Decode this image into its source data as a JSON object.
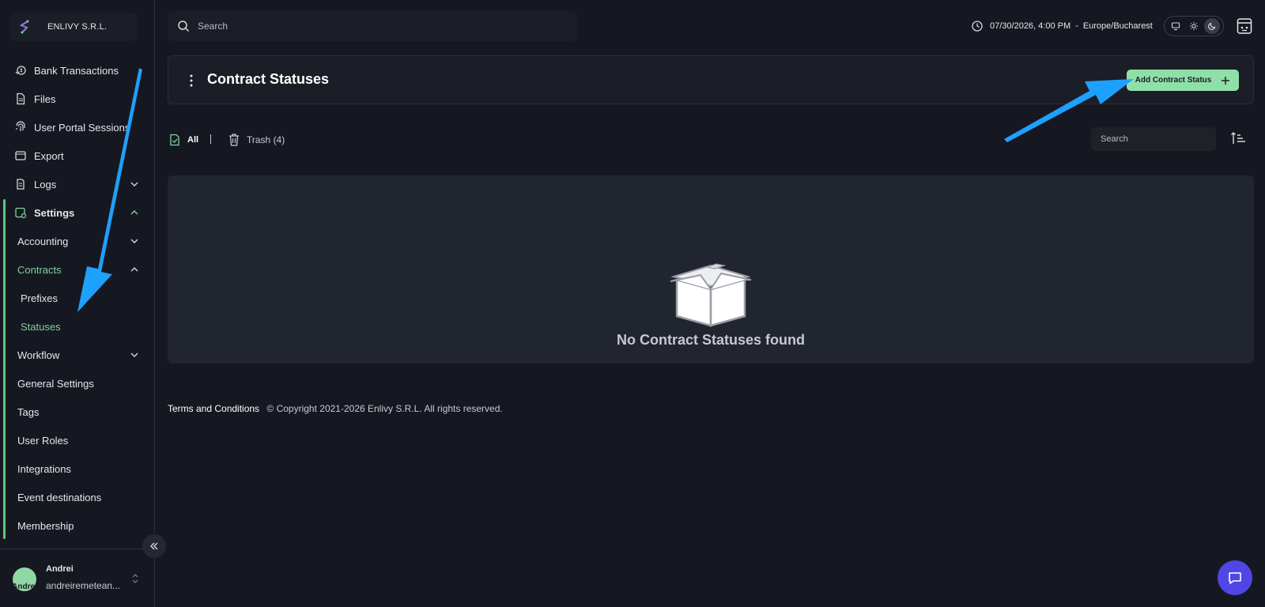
{
  "brand": {
    "name": "ENLIVY S.R.L."
  },
  "sidebar": {
    "items": [
      {
        "label": "Bank Transactions",
        "icon": "bank-transactions-icon"
      },
      {
        "label": "Files",
        "icon": "file-icon"
      },
      {
        "label": "User Portal Sessions",
        "icon": "fingerprint-icon"
      },
      {
        "label": "Export",
        "icon": "export-icon"
      },
      {
        "label": "Logs",
        "icon": "logs-icon"
      },
      {
        "label": "Settings",
        "icon": "settings-icon"
      }
    ],
    "settings_children": [
      {
        "label": "Accounting"
      },
      {
        "label": "Contracts"
      },
      {
        "label": "Prefixes"
      },
      {
        "label": "Statuses"
      },
      {
        "label": "Workflow"
      },
      {
        "label": "General Settings"
      },
      {
        "label": "Tags"
      },
      {
        "label": "User Roles"
      },
      {
        "label": "Integrations"
      },
      {
        "label": "Event destinations"
      },
      {
        "label": "Membership"
      }
    ],
    "accent_color": "#5cc77e"
  },
  "user": {
    "name": "Andrei",
    "email": "andreiremetean...",
    "avatar_text": "Andrei"
  },
  "topbar": {
    "search_placeholder": "Search",
    "datetime": "07/30/2026, 4:00 PM",
    "separator": "-",
    "timezone": "Europe/Bucharest",
    "theme_active": "dark"
  },
  "header": {
    "title": "Contract Statuses",
    "add_button_label": "Add Contract Status",
    "add_button_color": "#8fe0a8"
  },
  "filters": {
    "all_label": "All",
    "trash_label": "Trash (4)",
    "search_placeholder": "Search"
  },
  "empty_state": {
    "message": "No Contract Statuses found"
  },
  "footer": {
    "terms_label": "Terms and Conditions",
    "copyright": "© Copyright 2021-2026 Enlivy S.R.L. All rights reserved."
  },
  "annotation_color": "#1ea0ff"
}
